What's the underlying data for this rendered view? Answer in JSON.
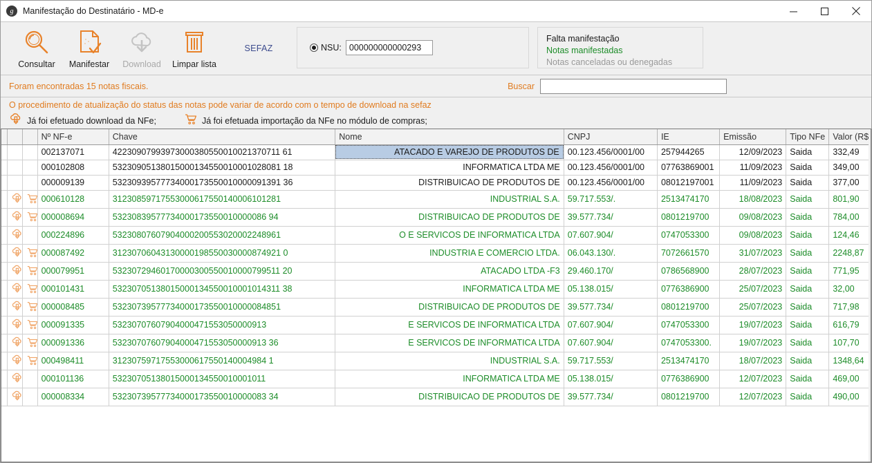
{
  "window": {
    "title": "Manifestação do Destinatário - MD-e",
    "app_icon": "app-logo-icon",
    "minimize": "−",
    "maximize": "□",
    "close": "✕"
  },
  "toolbar": {
    "buttons": [
      {
        "label": "Consultar",
        "icon": "magnifier-icon",
        "disabled": false
      },
      {
        "label": "Manifestar",
        "icon": "document-check-icon",
        "disabled": false
      },
      {
        "label": "Download",
        "icon": "cloud-download-icon",
        "disabled": true
      },
      {
        "label": "Limpar lista",
        "icon": "trash-icon",
        "disabled": false
      }
    ],
    "sefaz_label": "SEFAZ",
    "nsu": {
      "radio_label": "NSU:",
      "radio_selected": true,
      "value": "000000000000293",
      "placeholder": ""
    },
    "status_legend": [
      {
        "text": "Falta manifestação",
        "color": "#1b1b1b"
      },
      {
        "text": "Notas manifestadas",
        "color": "#1c8c28"
      },
      {
        "text": "Notas canceladas ou denegadas",
        "color": "#9a9a9a"
      }
    ]
  },
  "infobar": {
    "found_text": "Foram encontradas 15 notas fiscais.",
    "search_label": "Buscar",
    "search_value": "",
    "search_placeholder": ""
  },
  "notice": {
    "text": "O procedimento de atualização do status das notas pode variar de acordo com o tempo de download na sefaz",
    "legend": [
      {
        "icon": "cloud-download-icon",
        "label": "Já foi efetuado download da NFe;"
      },
      {
        "icon": "shopping-cart-icon",
        "label": "Já foi efetuada importação da NFe no módulo de compras;"
      }
    ]
  },
  "colors": {
    "accent_orange": "#e07b1f",
    "manifested_green": "#1c8c28",
    "disabled_gray": "#9a9a9a",
    "selection_blue": "#b8cce4",
    "sefaz_blue": "#3b4a8c"
  },
  "table": {
    "columns": [
      {
        "key": "pad",
        "label": ""
      },
      {
        "key": "dl",
        "label": ""
      },
      {
        "key": "imp",
        "label": ""
      },
      {
        "key": "num",
        "label": "Nº NF-e"
      },
      {
        "key": "chave",
        "label": "Chave"
      },
      {
        "key": "nome",
        "label": "Nome"
      },
      {
        "key": "cnpj",
        "label": "CNPJ"
      },
      {
        "key": "ie",
        "label": "IE"
      },
      {
        "key": "emis",
        "label": "Emissão"
      },
      {
        "key": "tipo",
        "label": "Tipo NFe"
      },
      {
        "key": "valor",
        "label": "Valor (R$)"
      }
    ],
    "rows": [
      {
        "dl": false,
        "imp": false,
        "num": "002137071",
        "chave": "42230907993973000380550010021370711 61",
        "nome": "ATACADO E VAREJO DE PRODUTOS DE",
        "cnpj": "00.123.456/0001/00",
        "ie": "257944265",
        "emis": "12/09/2023",
        "tipo": "Saida",
        "valor": "332,49",
        "manifested": false,
        "selected": true
      },
      {
        "dl": false,
        "imp": false,
        "num": "000102808",
        "chave": "53230905138015000134550010001028081 18",
        "nome": "INFORMATICA LTDA ME",
        "cnpj": "00.123.456/0001/00",
        "ie": "07763869001",
        "emis": "11/09/2023",
        "tipo": "Saida",
        "valor": "349,00",
        "manifested": false,
        "selected": false
      },
      {
        "dl": false,
        "imp": false,
        "num": "000009139",
        "chave": "53230939577734000173550010000091391 36",
        "nome": "DISTRIBUICAO DE PRODUTOS DE",
        "cnpj": "00.123.456/0001/00",
        "ie": "08012197001",
        "emis": "11/09/2023",
        "tipo": "Saida",
        "valor": "377,00",
        "manifested": false,
        "selected": false
      },
      {
        "dl": true,
        "imp": true,
        "num": "000610128",
        "chave": "31230859717553000617550140006101281",
        "nome": "INDUSTRIAL S.A.",
        "cnpj": "59.717.553/.",
        "ie": "2513474170",
        "emis": "18/08/2023",
        "tipo": "Saida",
        "valor": "801,90",
        "manifested": true,
        "selected": false
      },
      {
        "dl": true,
        "imp": true,
        "num": "000008694",
        "chave": "53230839577734000173550010000086 94",
        "nome": "DISTRIBUICAO DE PRODUTOS DE",
        "cnpj": "39.577.734/",
        "ie": "0801219700",
        "emis": "09/08/2023",
        "tipo": "Saida",
        "valor": "784,00",
        "manifested": true,
        "selected": false
      },
      {
        "dl": true,
        "imp": false,
        "num": "000224896",
        "chave": "53230807607904000200553020002248961",
        "nome": "O E SERVICOS DE INFORMATICA LTDA",
        "cnpj": "07.607.904/",
        "ie": "0747053300",
        "emis": "09/08/2023",
        "tipo": "Saida",
        "valor": "124,46",
        "manifested": true,
        "selected": false
      },
      {
        "dl": true,
        "imp": true,
        "num": "000087492",
        "chave": "31230706043130000198550030000874921 0",
        "nome": "INDUSTRIA E COMERCIO LTDA.",
        "cnpj": "06.043.130/.",
        "ie": "7072661570",
        "emis": "31/07/2023",
        "tipo": "Saida",
        "valor": "2248,87",
        "manifested": true,
        "selected": false
      },
      {
        "dl": true,
        "imp": true,
        "num": "000079951",
        "chave": "53230729460170000300550010000799511 20",
        "nome": "ATACADO LTDA -F3",
        "cnpj": "29.460.170/",
        "ie": "0786568900",
        "emis": "28/07/2023",
        "tipo": "Saida",
        "valor": "771,95",
        "manifested": true,
        "selected": false
      },
      {
        "dl": true,
        "imp": true,
        "num": "000101431",
        "chave": "53230705138015000134550010001014311 38",
        "nome": "INFORMATICA LTDA ME",
        "cnpj": "05.138.015/",
        "ie": "0776386900",
        "emis": "25/07/2023",
        "tipo": "Saida",
        "valor": "32,00",
        "manifested": true,
        "selected": false
      },
      {
        "dl": true,
        "imp": true,
        "num": "000008485",
        "chave": "53230739577734000173550010000084851",
        "nome": "DISTRIBUICAO DE PRODUTOS DE",
        "cnpj": "39.577.734/",
        "ie": "0801219700",
        "emis": "25/07/2023",
        "tipo": "Saida",
        "valor": "717,98",
        "manifested": true,
        "selected": false
      },
      {
        "dl": true,
        "imp": true,
        "num": "000091335",
        "chave": "53230707607904000471553050000913",
        "nome": "E SERVICOS DE INFORMATICA LTDA",
        "cnpj": "07.607.904/",
        "ie": "0747053300",
        "emis": "19/07/2023",
        "tipo": "Saida",
        "valor": "616,79",
        "manifested": true,
        "selected": false
      },
      {
        "dl": true,
        "imp": true,
        "num": "000091336",
        "chave": "53230707607904000471553050000913 36",
        "nome": "E SERVICOS DE INFORMATICA LTDA",
        "cnpj": "07.607.904/",
        "ie": "0747053300.",
        "emis": "19/07/2023",
        "tipo": "Saida",
        "valor": "107,70",
        "manifested": true,
        "selected": false
      },
      {
        "dl": true,
        "imp": true,
        "num": "000498411",
        "chave": "31230759717553000617550140004984 1",
        "nome": "INDUSTRIAL S.A.",
        "cnpj": "59.717.553/",
        "ie": "2513474170",
        "emis": "18/07/2023",
        "tipo": "Saida",
        "valor": "1348,64",
        "manifested": true,
        "selected": false
      },
      {
        "dl": true,
        "imp": false,
        "num": "000101136",
        "chave": "53230705138015000134550010001011",
        "nome": "INFORMATICA LTDA ME",
        "cnpj": "05.138.015/",
        "ie": "0776386900",
        "emis": "12/07/2023",
        "tipo": "Saida",
        "valor": "469,00",
        "manifested": true,
        "selected": false
      },
      {
        "dl": true,
        "imp": false,
        "num": "000008334",
        "chave": "53230739577734000173550010000083 34",
        "nome": "DISTRIBUICAO DE PRODUTOS DE",
        "cnpj": "39.577.734/",
        "ie": "0801219700",
        "emis": "12/07/2023",
        "tipo": "Saida",
        "valor": "490,00",
        "manifested": true,
        "selected": false
      }
    ]
  }
}
